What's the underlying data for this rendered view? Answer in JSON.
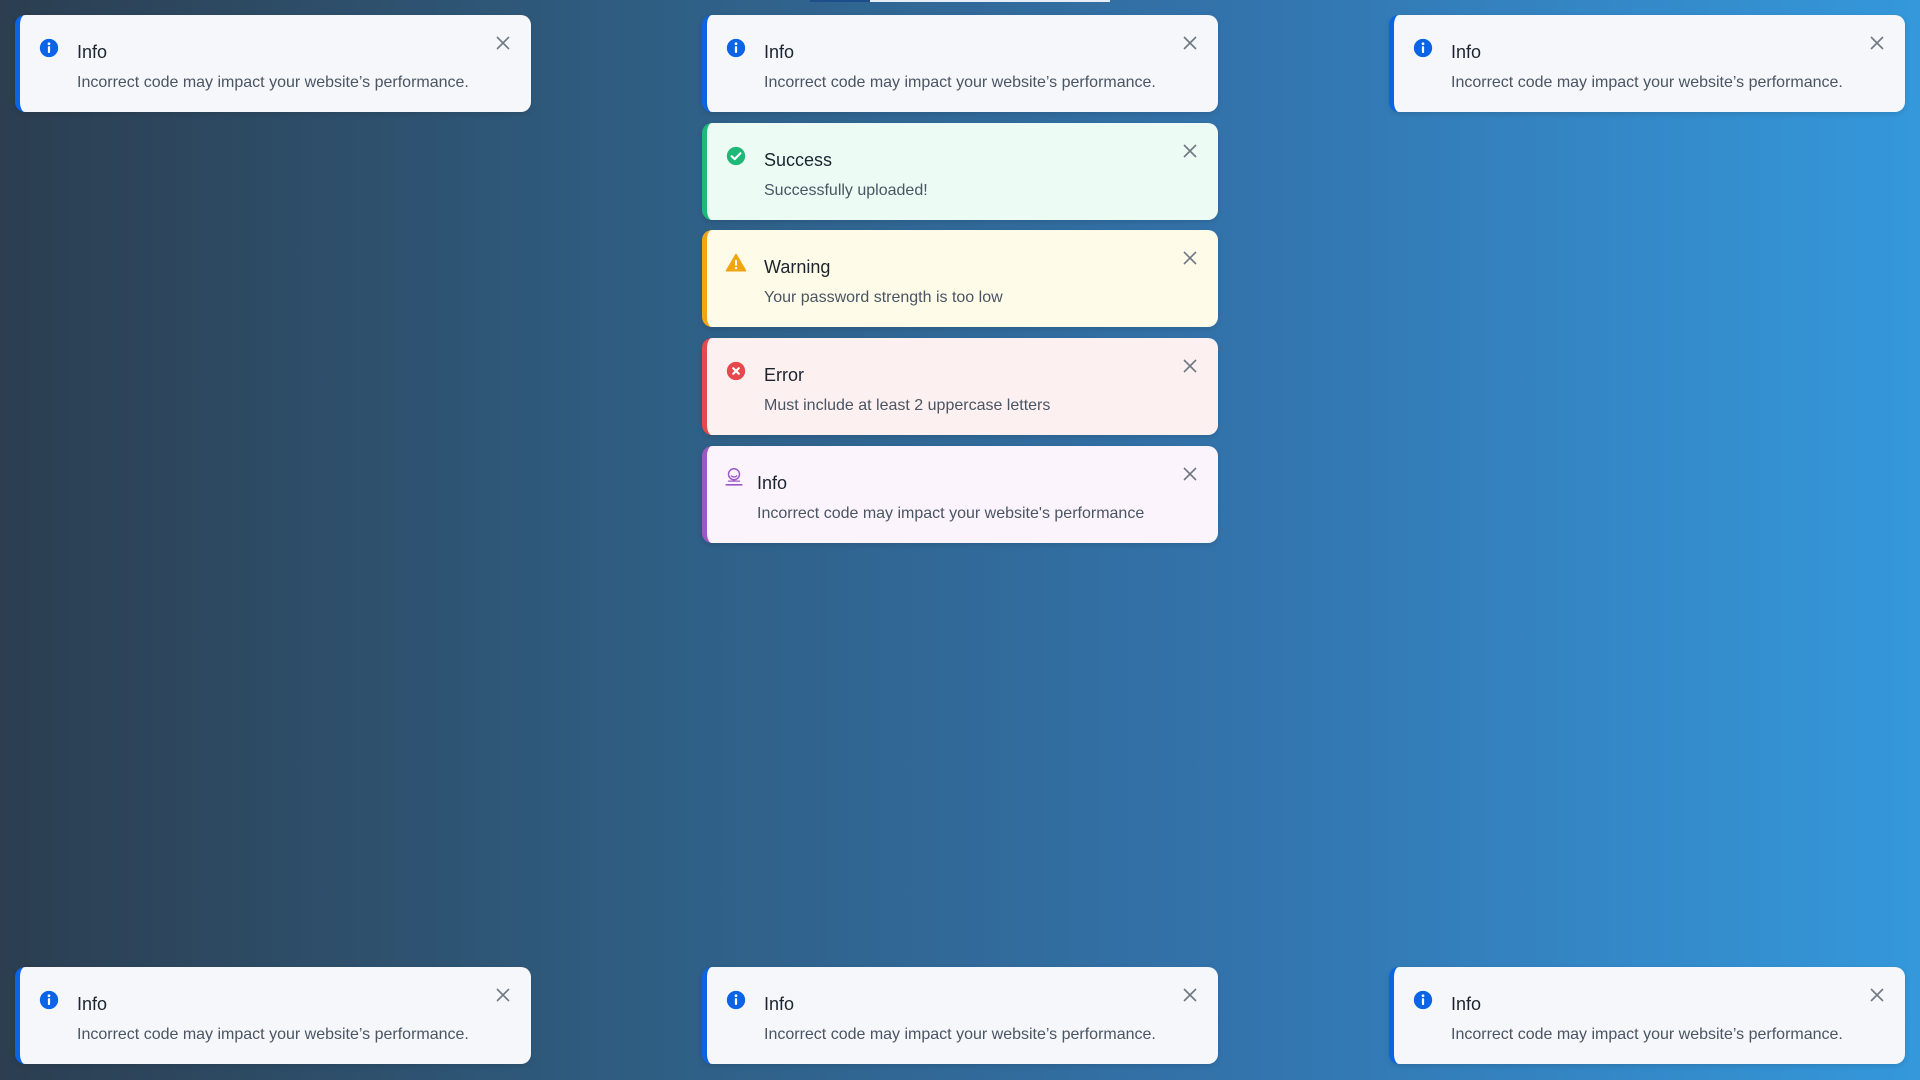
{
  "colors": {
    "info": "#0b63e5",
    "success": "#1fb877",
    "warning": "#f0a511",
    "error": "#e5484d",
    "custom": "#9b59c6"
  },
  "toasts": {
    "top_left": {
      "variant": "info",
      "icon": "info-icon",
      "title": "Info",
      "message": "Incorrect code may impact your website’s performance."
    },
    "top_center": [
      {
        "variant": "info",
        "icon": "info-icon",
        "title": "Info",
        "message": "Incorrect code may impact your website’s performance."
      },
      {
        "variant": "success",
        "icon": "check-circle-icon",
        "title": "Success",
        "message": "Successfully uploaded!"
      },
      {
        "variant": "warning",
        "icon": "warning-triangle-icon",
        "title": "Warning",
        "message": "Your password strength is too low"
      },
      {
        "variant": "error",
        "icon": "error-circle-icon",
        "title": "Error",
        "message": "Must include at least 2 uppercase letters"
      },
      {
        "variant": "custom",
        "icon": "user-badge-icon",
        "title": "Info",
        "message": "Incorrect code may impact your website's performance"
      }
    ],
    "top_right": {
      "variant": "info",
      "icon": "info-icon",
      "title": "Info",
      "message": "Incorrect code may impact your website’s performance."
    },
    "bottom_left": {
      "variant": "info",
      "icon": "info-icon",
      "title": "Info",
      "message": "Incorrect code may impact your website’s performance."
    },
    "bottom_center": {
      "variant": "info",
      "icon": "info-icon",
      "title": "Info",
      "message": "Incorrect code may impact your website’s performance."
    },
    "bottom_right": {
      "variant": "info",
      "icon": "info-icon",
      "title": "Info",
      "message": "Incorrect code may impact your website’s performance."
    }
  }
}
